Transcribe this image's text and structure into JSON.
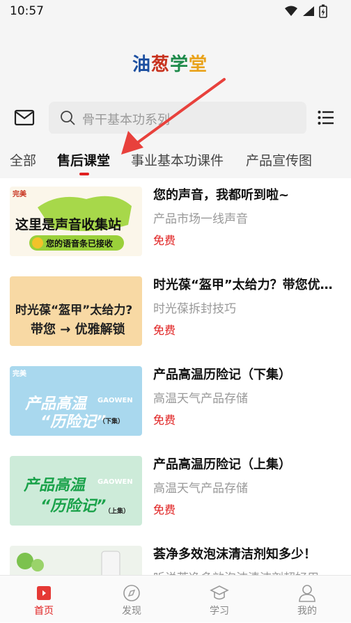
{
  "status_bar": {
    "time": "10:57"
  },
  "header": {
    "logo_chars": [
      "油",
      "葱",
      "学",
      "堂"
    ],
    "logo_colors": [
      "#1c4fa0",
      "#c8331f",
      "#1d8a4a",
      "#e9a21a"
    ]
  },
  "search": {
    "placeholder": "骨干基本功系列"
  },
  "tabs": [
    {
      "label": "全部"
    },
    {
      "label": "售后课堂"
    },
    {
      "label": "事业基本功课件"
    },
    {
      "label": "产品宣传图"
    }
  ],
  "active_tab_index": 1,
  "accent_color": "#e02020",
  "items": [
    {
      "title": "您的声音，我都听到啦~",
      "subtitle": "产品市场一线声音",
      "price": "免费",
      "thumb": {
        "brand": "完美",
        "line1": "这里是声音收集站",
        "line2": "您的语音条已接收"
      }
    },
    {
      "title": "时光葆“盔甲”太给力？带您优…",
      "subtitle": "时光葆拆封技巧",
      "price": "免费",
      "thumb": {
        "line1": "时光葆“盔甲”太给力?",
        "line2": "带您 → 优雅解锁"
      }
    },
    {
      "title": "产品高温历险记（下集）",
      "subtitle": "高温天气产品存储",
      "price": "免费",
      "thumb": {
        "brand": "完美",
        "line1": "产品高温",
        "tag": "GAOWEN",
        "line2": "“历险记”",
        "episode": "（下集）"
      }
    },
    {
      "title": "产品高温历险记（上集）",
      "subtitle": "高温天气产品存储",
      "price": "免费",
      "thumb": {
        "line1": "产品高温",
        "tag": "GAOWEN",
        "line2": "“历险记”",
        "episode": "（上集）"
      }
    },
    {
      "title": "荟净多效泡沫清洁剂知多少！",
      "subtitle": "听说荟净多效泡沫清洁剂超好用",
      "price": "",
      "thumb": {}
    }
  ],
  "bottom_nav": [
    {
      "label": "首页",
      "icon": "home-icon"
    },
    {
      "label": "发现",
      "icon": "compass-icon"
    },
    {
      "label": "学习",
      "icon": "graduation-cap-icon"
    },
    {
      "label": "我的",
      "icon": "user-icon"
    }
  ],
  "active_nav_index": 0
}
